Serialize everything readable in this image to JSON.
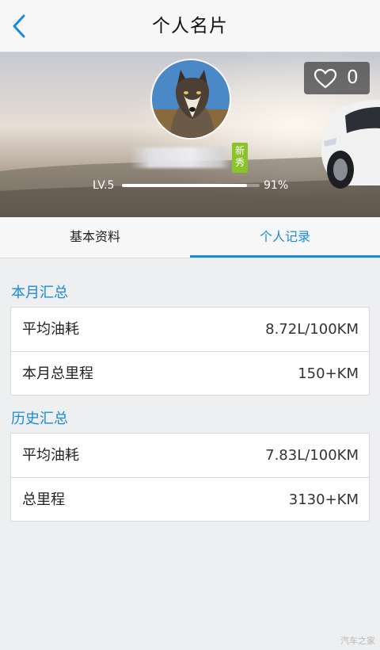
{
  "navbar": {
    "title": "个人名片",
    "back_icon": "chevron-left-icon",
    "accent_color": "#1a8ad6"
  },
  "profile": {
    "avatar_icon": "wolf-avatar",
    "likes": "0",
    "like_icon": "heart-outline-icon",
    "badge_chars": [
      "新",
      "秀"
    ],
    "level_label": "LV.5",
    "progress_fraction": 0.91,
    "progress_label": "91%"
  },
  "tabs": [
    {
      "label": "基本资料",
      "active": false
    },
    {
      "label": "个人记录",
      "active": true
    }
  ],
  "sections": [
    {
      "title": "本月汇总",
      "rows": [
        {
          "label": "平均油耗",
          "value": "8.72L/100KM"
        },
        {
          "label": "本月总里程",
          "value": "150+KM"
        }
      ]
    },
    {
      "title": "历史汇总",
      "rows": [
        {
          "label": "平均油耗",
          "value": "7.83L/100KM"
        },
        {
          "label": "总里程",
          "value": "3130+KM"
        }
      ]
    }
  ],
  "watermark": "汽车之家"
}
